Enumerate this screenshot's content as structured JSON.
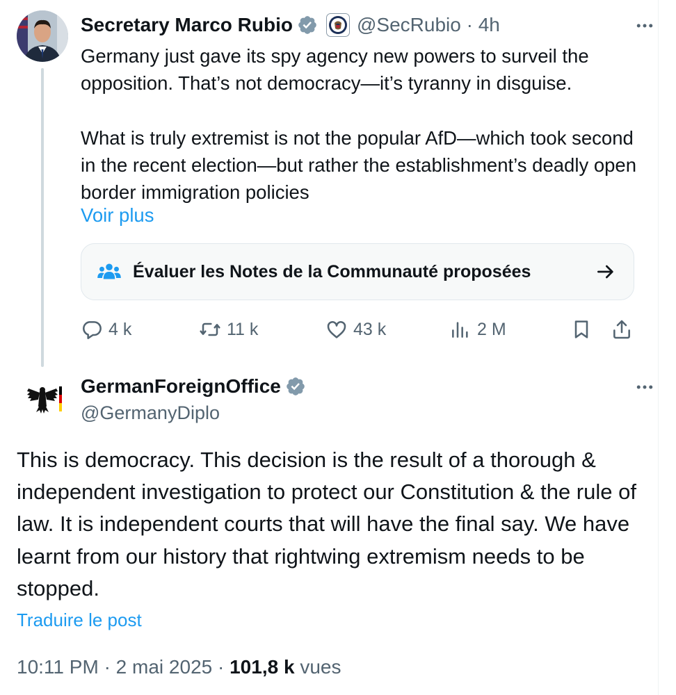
{
  "tweet1": {
    "author_name": "Secretary Marco Rubio",
    "handle": "@SecRubio",
    "time": "4h",
    "paragraph1": "Germany just gave its spy agency new powers to surveil the opposition.  That’s not democracy—it’s tyranny in disguise.",
    "paragraph2": "What is truly extremist is not the popular AfD—which took second in the recent election—but rather the establishment’s deadly open border immigration policies",
    "show_more": "Voir plus",
    "community_notes_label": "Évaluer les Notes de la Communauté proposées",
    "stats": {
      "replies": "4 k",
      "reposts": "11 k",
      "likes": "43 k",
      "views": "2 M"
    }
  },
  "tweet2": {
    "author_name": "GermanForeignOffice",
    "handle": "@GermanyDiplo",
    "body": "This is democracy. This decision is the result of a thorough & independent investigation to protect our Constitution & the rule of law. It is independent courts that will have the final say. We have learnt from our history that rightwing extremism needs to be stopped.",
    "translate": "Traduire le post",
    "time": "10:11 PM",
    "date": "2 mai 2025",
    "views_count": "101,8 k",
    "views_label": "vues"
  },
  "icons": {
    "verified": "verified-badge-icon",
    "more": "more-dots-icon",
    "community_notes": "people-icon",
    "arrow": "arrow-right-icon",
    "reply": "reply-icon",
    "repost": "repost-icon",
    "like": "heart-icon",
    "views": "views-chart-icon",
    "bookmark": "bookmark-icon",
    "share": "share-icon"
  },
  "colors": {
    "accent": "#1d9bf0",
    "text": "#0f1419",
    "secondary_text": "#536471",
    "verified_gray": "#829aab",
    "thread_line": "#cfd9de"
  }
}
